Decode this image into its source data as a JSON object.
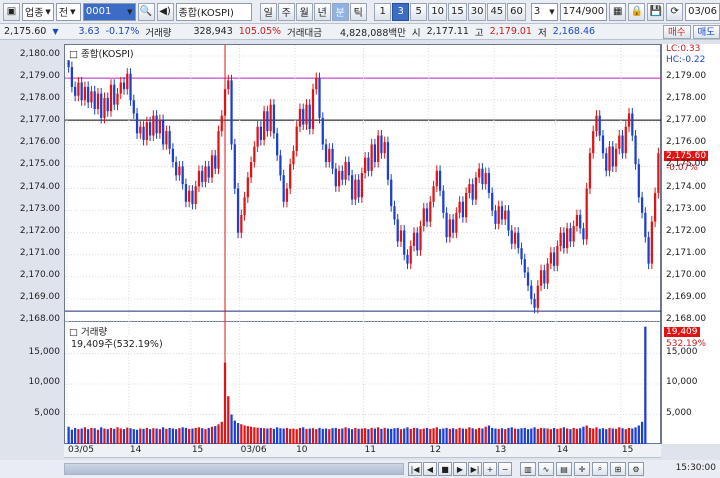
{
  "toolbar": {
    "market_select": "업종",
    "jeon": "전",
    "code": "0001",
    "name": "종합(KOSPI)",
    "periods": [
      "일",
      "주",
      "월",
      "년",
      "분",
      "틱"
    ],
    "active_period": "분",
    "intervals": [
      "1",
      "3",
      "5",
      "10",
      "15",
      "30",
      "45",
      "60"
    ],
    "active_interval": "3",
    "count_select": "3",
    "range": "174/900",
    "date": "03/06"
  },
  "info": {
    "price": "2,175.60",
    "change": "3.63",
    "change_pct": "-0.17%",
    "volume_label": "거래량",
    "volume": "328,943",
    "volume_pct": "105.05%",
    "amount_label": "거래대금",
    "amount": "4,828,088백만",
    "open_label": "시",
    "open": "2,177.11",
    "high_label": "고",
    "high": "2,179.01",
    "low_label": "저",
    "low": "2,168.46",
    "buy": "매수",
    "sell": "매도"
  },
  "price_panel": {
    "legend": "종합(KOSPI)",
    "lc": "LC:0.33",
    "hc": "HC:-0.22",
    "cur_price_tag": "2,175.60",
    "cur_pct_tag": "-0.07%",
    "yticks": [
      "2,180.00",
      "2,179.00",
      "2,178.00",
      "2,177.00",
      "2,176.00",
      "2,175.00",
      "2,174.00",
      "2,173.00",
      "2,172.00",
      "2,171.00",
      "2,170.00",
      "2,169.00",
      "2,168.00"
    ]
  },
  "volume_panel": {
    "legend": "거래량",
    "legend_value": "19,409주(532.19%)",
    "cur_tag": "19,409",
    "cur_pct": "532.19%",
    "yticks": [
      "15,000",
      "10,000",
      "5,000"
    ]
  },
  "xaxis": {
    "labels": [
      "03/05",
      "14",
      "15",
      "03/06",
      "10",
      "11",
      "12",
      "13",
      "14",
      "15"
    ]
  },
  "status": {
    "time": "15:30:00"
  },
  "colors": {
    "up": "#e01414",
    "down": "#1a3fd1",
    "magenta": "#c020c0",
    "navy": "#1a2a7a"
  },
  "chart_data": {
    "type": "candlestick",
    "ylim": [
      2168,
      2180.5
    ],
    "volume_ylim": [
      0,
      20000
    ],
    "reference_lines": [
      {
        "value": 2179.0,
        "color": "#c020c0"
      },
      {
        "value": 2177.1,
        "color": "#000000"
      },
      {
        "value": 2168.45,
        "color": "#1a2a7a"
      }
    ],
    "closes": [
      2179.5,
      2178.6,
      2178.2,
      2178.8,
      2178.0,
      2178.6,
      2177.9,
      2178.4,
      2177.6,
      2178.3,
      2177.2,
      2178.1,
      2177.5,
      2178.7,
      2177.8,
      2178.3,
      2178.8,
      2178.5,
      2179.2,
      2178.0,
      2177.4,
      2176.5,
      2176.8,
      2176.2,
      2177.0,
      2176.4,
      2177.3,
      2176.5,
      2177.1,
      2176.0,
      2176.6,
      2175.8,
      2175.2,
      2174.6,
      2175.0,
      2174.2,
      2173.4,
      2173.9,
      2173.3,
      2174.1,
      2174.8,
      2174.3,
      2175.0,
      2174.5,
      2175.5,
      2174.9,
      2176.6,
      2177.3,
      2178.5,
      2178.9,
      2176.0,
      2174.0,
      2172.0,
      2172.8,
      2173.6,
      2174.5,
      2175.2,
      2175.9,
      2176.8,
      2176.2,
      2177.5,
      2176.6,
      2177.8,
      2176.5,
      2175.5,
      2174.6,
      2173.4,
      2174.0,
      2175.1,
      2175.7,
      2176.8,
      2177.6,
      2176.9,
      2177.8,
      2176.7,
      2178.5,
      2179.0,
      2177.2,
      2176.0,
      2175.2,
      2175.8,
      2174.9,
      2174.1,
      2174.8,
      2174.4,
      2175.2,
      2174.6,
      2173.5,
      2174.4,
      2173.6,
      2174.7,
      2175.4,
      2174.8,
      2176.0,
      2175.2,
      2176.4,
      2175.6,
      2176.1,
      2174.4,
      2173.2,
      2172.6,
      2171.6,
      2172.1,
      2171.0,
      2170.6,
      2171.4,
      2172.0,
      2171.2,
      2172.3,
      2173.1,
      2172.5,
      2173.4,
      2174.1,
      2174.8,
      2173.9,
      2172.9,
      2171.8,
      2172.6,
      2172.0,
      2172.9,
      2173.4,
      2172.7,
      2173.8,
      2174.2,
      2173.5,
      2174.5,
      2174.9,
      2174.2,
      2174.7,
      2173.8,
      2173.0,
      2172.4,
      2173.2,
      2172.6,
      2173.0,
      2172.1,
      2171.5,
      2172.0,
      2171.3,
      2170.8,
      2170.2,
      2169.6,
      2169.0,
      2168.6,
      2169.6,
      2170.3,
      2169.7,
      2170.6,
      2171.1,
      2170.5,
      2171.4,
      2172.0,
      2171.3,
      2172.2,
      2171.6,
      2172.3,
      2172.8,
      2172.2,
      2171.7,
      2174.0,
      2175.6,
      2176.6,
      2177.3,
      2176.4,
      2175.6,
      2174.8,
      2175.9,
      2175.0,
      2175.8,
      2176.4,
      2175.6,
      2176.8,
      2177.4,
      2176.4,
      2175.1,
      2173.6,
      2172.9,
      2171.8,
      2170.6,
      2172.5,
      2173.8,
      2175.6
    ],
    "volumes": [
      3000,
      2500,
      2800,
      2600,
      2700,
      2900,
      2600,
      2800,
      2750,
      2500,
      2900,
      2700,
      2600,
      2800,
      2650,
      2900,
      2700,
      2600,
      2850,
      2750,
      2600,
      2500,
      2700,
      2650,
      2800,
      2600,
      2750,
      2700,
      2600,
      2900,
      2650,
      2800,
      2700,
      2600,
      2750,
      2900,
      2800,
      2650,
      2700,
      2800,
      2900,
      2750,
      2600,
      2800,
      3000,
      3100,
      3400,
      3800,
      13500,
      8000,
      5000,
      4000,
      3600,
      3400,
      3200,
      3100,
      3000,
      2900,
      2850,
      2800,
      2750,
      2700,
      2800,
      2650,
      2900,
      2750,
      2700,
      2800,
      2650,
      2700,
      2600,
      2800,
      2900,
      2650,
      2700,
      2750,
      2600,
      2800,
      2650,
      2700,
      2600,
      2750,
      2800,
      2650,
      2700,
      2900,
      2750,
      2600,
      2800,
      2650,
      2700,
      2750,
      2600,
      2800,
      2700,
      2900,
      2650,
      2800,
      2700,
      2650,
      2750,
      2800,
      2600,
      2700,
      2900,
      2650,
      2800,
      2750,
      2600,
      2700,
      2800,
      2650,
      2750,
      2900,
      2600,
      2700,
      2800,
      2650,
      2750,
      2600,
      2800,
      2700,
      2650,
      2900,
      2750,
      2600,
      2800,
      2700,
      3000,
      3200,
      2800,
      2700,
      2650,
      2750,
      2600,
      2800,
      2900,
      2700,
      2650,
      2750,
      2800,
      2600,
      2700,
      2900,
      2650,
      2800,
      2750,
      2700,
      2600,
      2800,
      2650,
      2750,
      2900,
      2700,
      2600,
      2800,
      2650,
      2750,
      3000,
      3200,
      2800,
      2700,
      2900,
      2650,
      2750,
      2600,
      2800,
      2700,
      2650,
      2900,
      2750,
      2600,
      2800,
      2700,
      2900,
      3200,
      3800,
      19409
    ]
  }
}
